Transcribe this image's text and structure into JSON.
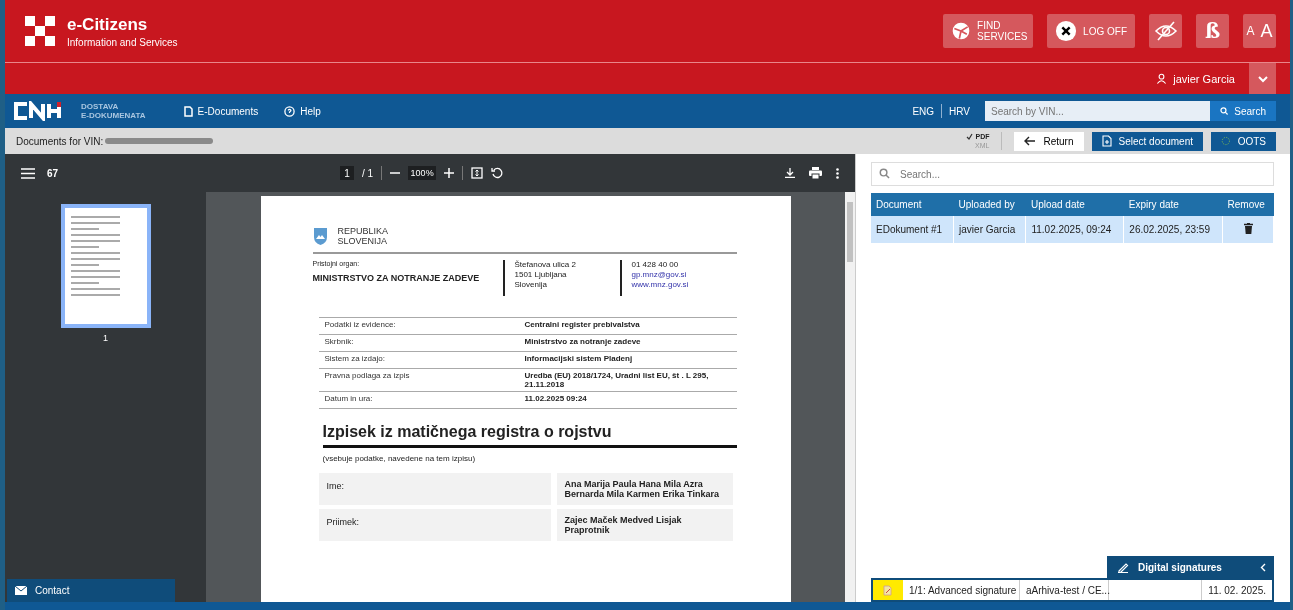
{
  "header": {
    "title": "e-Citizens",
    "subtitle": "Information and Services",
    "buttons": [
      {
        "kind": "find",
        "label": "FIND SERVICES"
      },
      {
        "kind": "logoff",
        "label": "LOG OFF"
      },
      {
        "kind": "visibility"
      },
      {
        "kind": "font",
        "glyph": "ß"
      },
      {
        "kind": "textsize",
        "glyphs": [
          "A",
          "A"
        ]
      }
    ]
  },
  "user": {
    "name": "javier Garcia"
  },
  "nav": {
    "brand": [
      "DOSTAVA",
      "E-DOKUMENATA"
    ],
    "links": [
      {
        "kind": "doc",
        "label": "E-Documents"
      },
      {
        "kind": "help",
        "label": "Help"
      }
    ],
    "languages": [
      "ENG",
      "HRV"
    ],
    "search": {
      "placeholder": "Search by VIN...",
      "button": "Search"
    }
  },
  "docs_bar": {
    "label": "Documents for VIN:",
    "formats": [
      {
        "label": "PDF",
        "selected": true
      },
      {
        "label": "XML",
        "selected": false
      }
    ],
    "buttons": [
      {
        "kind": "return",
        "label": "Return"
      },
      {
        "kind": "select",
        "label": "Select document"
      },
      {
        "kind": "oots",
        "label": "OOTS"
      }
    ]
  },
  "viewer": {
    "title": "67",
    "page": "1",
    "pages": "/ 1",
    "zoom": "100%",
    "thumbnail_label": "1"
  },
  "document": {
    "republic": [
      "REPUBLIKA",
      "SLOVENIJA"
    ],
    "organ_label": "Pristojni organ:",
    "organ": "MINISTRSTVO ZA NOTRANJE ZADEVE",
    "address": [
      "Štefanova ulica 2",
      "1501 Ljubljana",
      "Slovenija"
    ],
    "contact": [
      "01 428 40 00",
      "gp.mnz@gov.si",
      "www.mnz.gov.si"
    ],
    "rows": [
      {
        "label": "Podatki iz evidence:",
        "value": "Centralni register prebivalstva"
      },
      {
        "label": "Skrbnik:",
        "value": "Ministrstvo za notranje zadeve"
      },
      {
        "label": "Sistem za izdajo:",
        "value": "Informacijski sistem Pladenj"
      },
      {
        "label": "Pravna podlaga za izpis",
        "value": "Uredba (EU) 2018/1724, Uradni list EU, št . L 295, 21.11.2018"
      },
      {
        "label": "Datum in ura:",
        "value": "11.02.2025 09:24"
      }
    ],
    "title": "Izpisek iz matičnega registra o rojstvu",
    "note": "(vsebuje podatke, navedene na tem izpisu)",
    "fields": [
      {
        "label": "Ime:",
        "value": "Ana Marija Paula Hana Mila Azra Bernarda Mila Karmen Erika Tinkara"
      },
      {
        "label": "Priimek:",
        "value": "Zajec Maček Medved Lisjak Praprotnik"
      }
    ]
  },
  "contact": {
    "label": "Contact"
  },
  "documents": {
    "search_placeholder": "Search...",
    "columns": [
      "Document",
      "Uploaded by",
      "Upload date",
      "Expiry date",
      "Remove"
    ],
    "rows": [
      {
        "document": "EDokument #1",
        "uploaded_by": "javier Garcia",
        "upload_date": "11.02.2025, 09:24",
        "expiry_date": "26.02.2025, 23:59",
        "selected": true
      }
    ]
  },
  "signatures": {
    "title": "Digital signatures",
    "rows": [
      {
        "name": "1/1: Advanced signature",
        "issuer": "aArhiva-test / CE...",
        "date": "11. 02. 2025."
      }
    ]
  }
}
